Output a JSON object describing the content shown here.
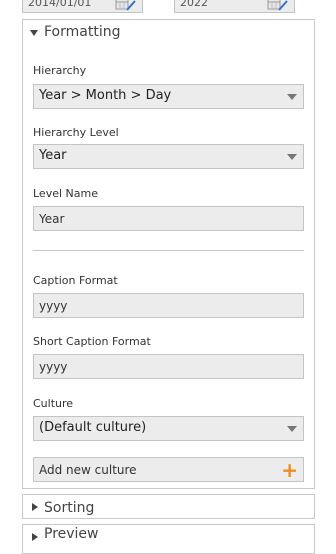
{
  "date_range": {
    "start": "2014/01/01",
    "end": "2022"
  },
  "icons": {
    "calendar": "calendar-edit-icon",
    "expanded": "triangle-down-icon",
    "collapsed": "triangle-right-icon",
    "dropdown": "dropdown-arrow-icon",
    "add": "plus-icon"
  },
  "colors": {
    "accent": "#f08a24",
    "field_bg": "#ececec",
    "border": "#c4c4c4"
  },
  "formatting": {
    "title": "Formatting",
    "hierarchy_label": "Hierarchy",
    "hierarchy_value": "Year > Month > Day",
    "level_label": "Hierarchy Level",
    "level_value": "Year",
    "level_name_label": "Level Name",
    "level_name_value": "Year",
    "caption_label": "Caption Format",
    "caption_value": "yyyy",
    "short_caption_label": "Short Caption Format",
    "short_caption_value": "yyyy",
    "culture_label": "Culture",
    "culture_value": "(Default culture)",
    "add_culture_label": "Add new culture",
    "add_symbol": "+"
  },
  "sorting": {
    "title": "Sorting"
  },
  "preview": {
    "title": "Preview"
  }
}
